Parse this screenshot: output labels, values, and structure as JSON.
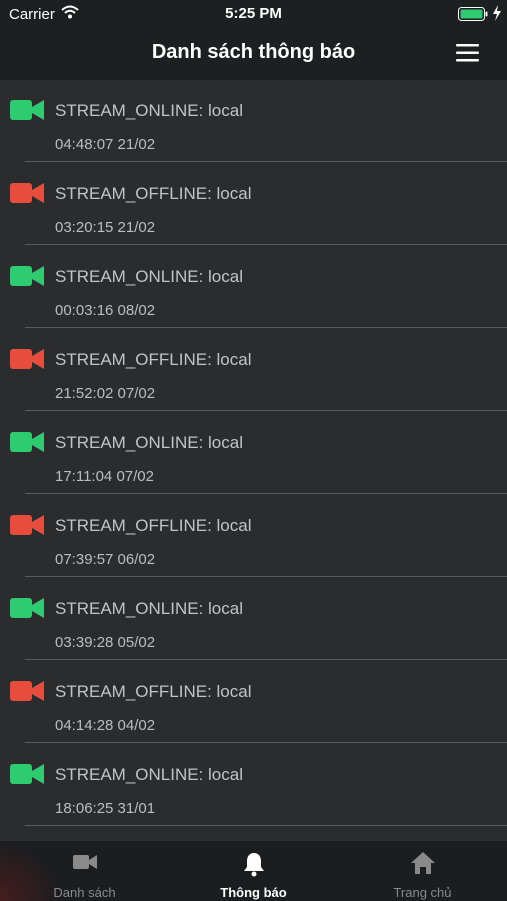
{
  "status_bar": {
    "carrier": "Carrier",
    "time": "5:25 PM"
  },
  "nav": {
    "title": "Danh sách thông báo",
    "menu_icon": "hamburger-menu-icon"
  },
  "colors": {
    "online": "#2ecc71",
    "offline": "#e74c3c"
  },
  "notifications": [
    {
      "status": "online",
      "icon": "video-camera-icon",
      "title": "STREAM_ONLINE: local",
      "time": "04:48:07 21/02"
    },
    {
      "status": "offline",
      "icon": "video-camera-icon",
      "title": "STREAM_OFFLINE: local",
      "time": "03:20:15 21/02"
    },
    {
      "status": "online",
      "icon": "video-camera-icon",
      "title": "STREAM_ONLINE: local",
      "time": "00:03:16 08/02"
    },
    {
      "status": "offline",
      "icon": "video-camera-icon",
      "title": "STREAM_OFFLINE: local",
      "time": "21:52:02 07/02"
    },
    {
      "status": "online",
      "icon": "video-camera-icon",
      "title": "STREAM_ONLINE: local",
      "time": "17:11:04 07/02"
    },
    {
      "status": "offline",
      "icon": "video-camera-icon",
      "title": "STREAM_OFFLINE: local",
      "time": "07:39:57 06/02"
    },
    {
      "status": "online",
      "icon": "video-camera-icon",
      "title": "STREAM_ONLINE: local",
      "time": "03:39:28 05/02"
    },
    {
      "status": "offline",
      "icon": "video-camera-icon",
      "title": "STREAM_OFFLINE: local",
      "time": "04:14:28 04/02"
    },
    {
      "status": "online",
      "icon": "video-camera-icon",
      "title": "STREAM_ONLINE: local",
      "time": "18:06:25 31/01"
    }
  ],
  "tabs": [
    {
      "label": "Danh sách",
      "icon": "video-camera-icon",
      "active": false
    },
    {
      "label": "Thông báo",
      "icon": "bell-icon",
      "active": true
    },
    {
      "label": "Trang chủ",
      "icon": "home-icon",
      "active": false
    }
  ]
}
